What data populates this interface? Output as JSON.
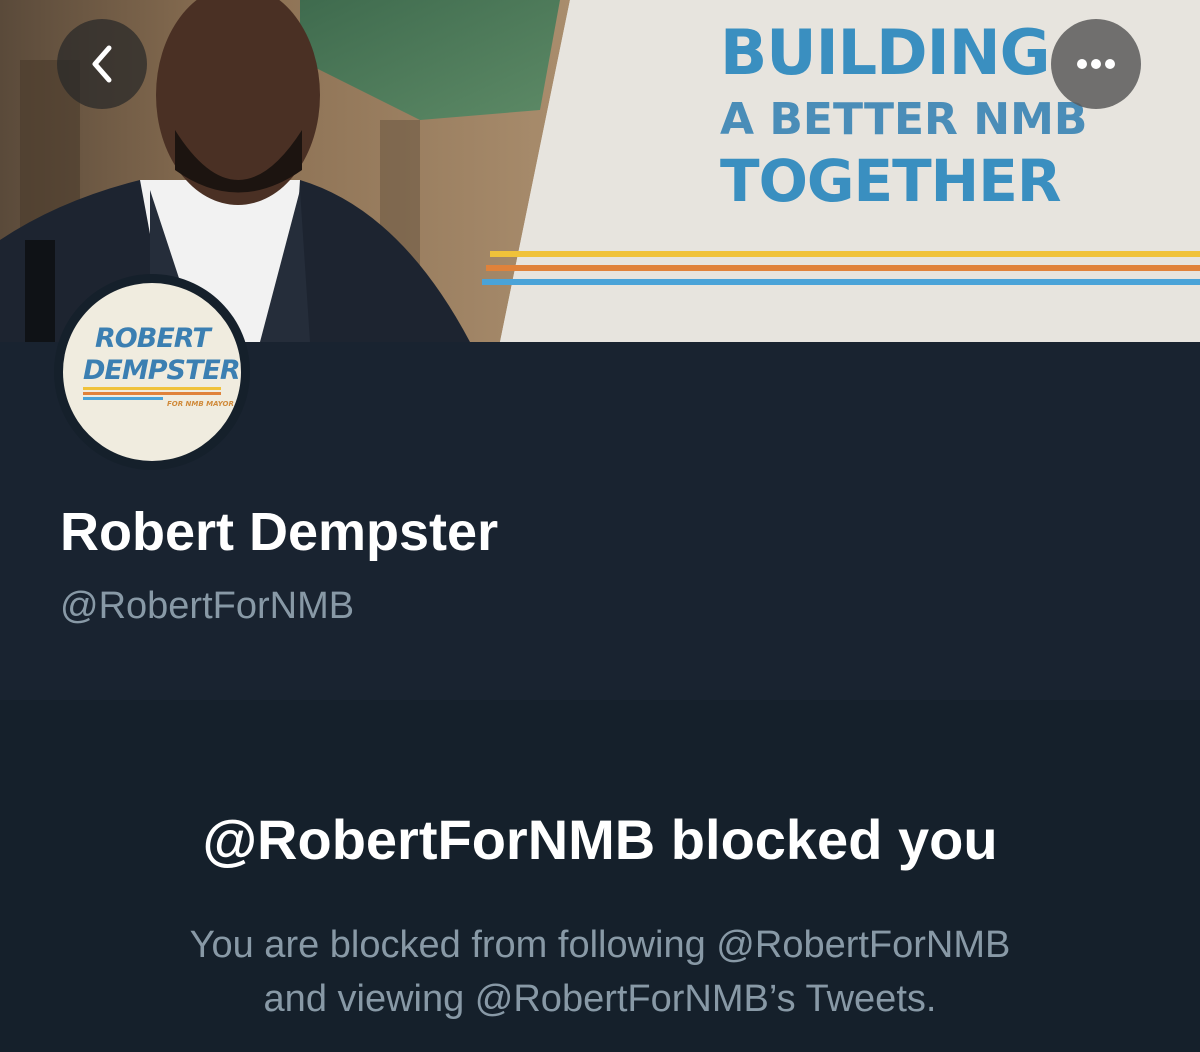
{
  "header": {
    "banner": {
      "line1": "BUILDING",
      "line2": "A BETTER NMB",
      "line3": "TOGETHER",
      "accent_blue": "#3a8fc0",
      "stripe_colors": [
        "#f0c23a",
        "#e0823a",
        "#4aa3d8"
      ]
    },
    "back_icon": "chevron-left-icon",
    "more_icon": "more-horizontal-icon"
  },
  "profile": {
    "avatar_logo": {
      "line1": "ROBERT",
      "line2": "DEMPSTER",
      "sub": "FOR NMB MAYOR"
    },
    "name": "Robert Dempster",
    "handle": "@RobertForNMB"
  },
  "blocked": {
    "title": "@RobertForNMB blocked you",
    "description_line1": "You are blocked from following @RobertForNMB",
    "description_line2": "and viewing @RobertForNMB’s Tweets."
  },
  "colors": {
    "background": "#15202b",
    "profile_bg": "#192330",
    "text_primary": "#ffffff",
    "text_secondary": "#8899a6"
  }
}
